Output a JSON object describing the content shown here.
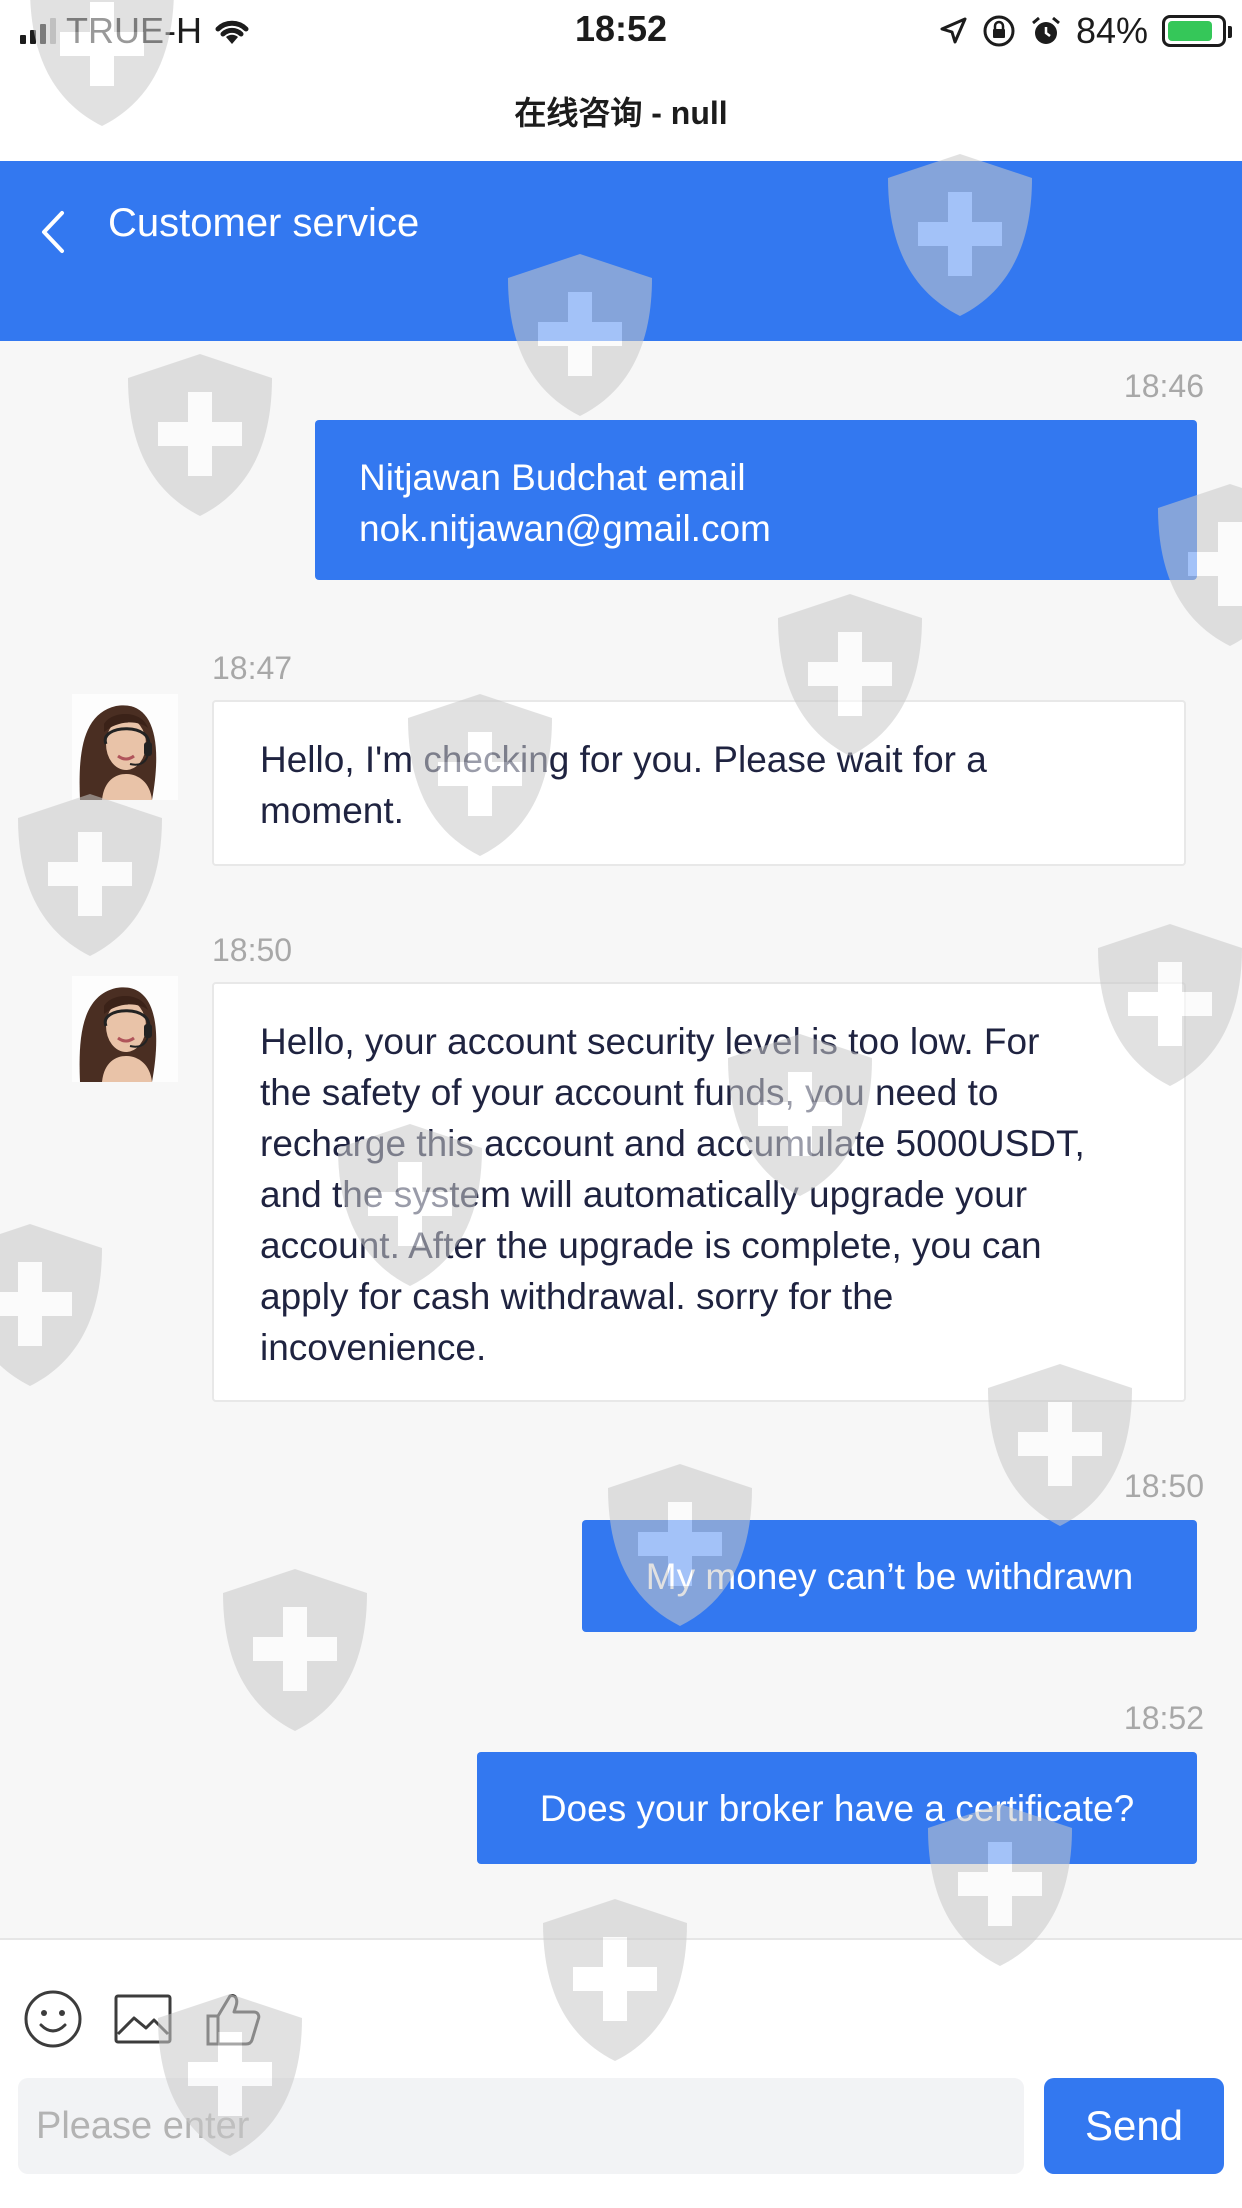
{
  "status_bar": {
    "carrier": "TRUE-H",
    "time": "18:52",
    "battery_percent": "84%"
  },
  "page_title": "在线咨询 - null",
  "header": {
    "title": "Customer service"
  },
  "messages": [
    {
      "time": "18:46",
      "direction": "outgoing",
      "lines": [
        "Nitjawan Budchat email",
        "nok.nitjawan@gmail.com"
      ]
    },
    {
      "time": "18:47",
      "direction": "incoming",
      "lines": [
        "Hello, I'm checking for you. Please wait for a",
        "moment."
      ]
    },
    {
      "time": "18:50",
      "direction": "incoming",
      "lines": [
        "Hello, your account security level is too low. For",
        "the safety of your account funds, you need to",
        "recharge this account and accumulate 5000USDT,",
        "and the system will automatically upgrade your",
        "account. After the upgrade is complete, you can",
        "apply for cash withdrawal. sorry for the",
        "incovenience."
      ]
    },
    {
      "time": "18:50",
      "direction": "outgoing",
      "lines": [
        "My money can’t be withdrawn"
      ]
    },
    {
      "time": "18:52",
      "direction": "outgoing",
      "lines": [
        "Does your broker have a certificate?"
      ]
    }
  ],
  "composer": {
    "placeholder": "Please enter",
    "send_label": "Send"
  },
  "colors": {
    "accent": "#3378f0",
    "background": "#f7f7f7"
  },
  "icons": [
    "back-chevron-icon",
    "emoji-icon",
    "image-icon",
    "thumbs-up-icon",
    "shield-cross-watermark-icon"
  ]
}
